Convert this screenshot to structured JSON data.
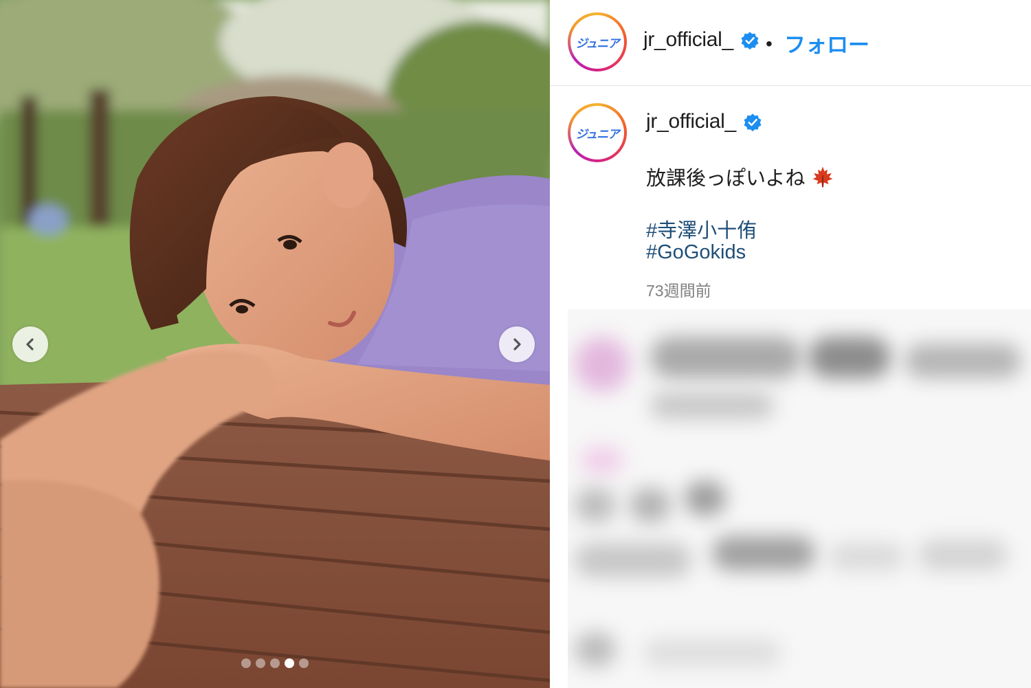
{
  "post": {
    "username": "jr_official_",
    "separator": "•",
    "follow_label": "フォロー",
    "avatar_label": "ジュニア",
    "caption": "放課後っぽいよね",
    "caption_emoji": "maple-leaf-icon",
    "hashtags": [
      "#寺澤小十侑",
      "#GoGokids"
    ],
    "timestamp": "73週間前"
  },
  "carousel": {
    "slide_count": 5,
    "active_index": 3,
    "prev_icon": "chevron-left-icon",
    "next_icon": "chevron-right-icon"
  },
  "colors": {
    "link": "#1d8ef0",
    "hashtag": "#1f4e78",
    "verified": "#1d8ef0",
    "text": "#1e1e1e",
    "muted": "#808080"
  }
}
